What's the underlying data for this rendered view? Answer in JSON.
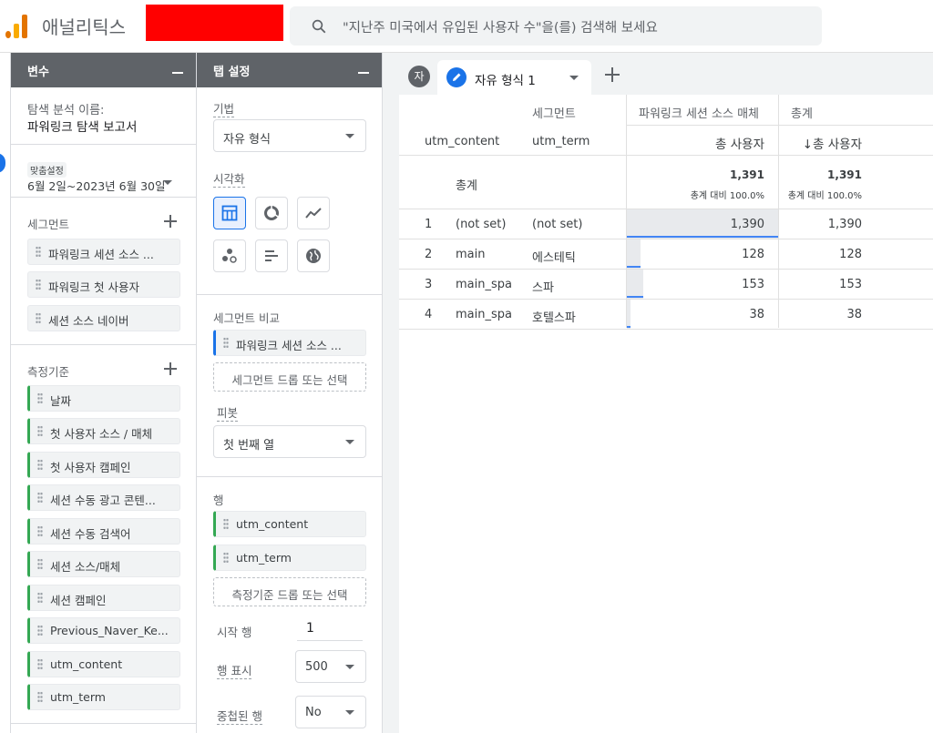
{
  "app": {
    "title": "애널리틱스",
    "search_placeholder": "\"지난주 미국에서 유입된 사용자 수\"을(를) 검색해 보세요"
  },
  "variables_panel": {
    "title": "변수",
    "exploration_name_label": "탐색 분석 이름:",
    "exploration_name": "파워링크 탐색 보고서",
    "date_badge": "맞춤설정",
    "date_range": "6월 2일~2023년 6월 30일",
    "segments_label": "세그먼트",
    "segments": [
      "파워링크 세션 소스 ...",
      "파워링크 첫 사용자",
      "세션 소스 네이버"
    ],
    "dimensions_label": "측정기준",
    "dimensions": [
      "날짜",
      "첫 사용자 소스 / 매체",
      "첫 사용자 캠페인",
      "세션 수동 광고 콘텐...",
      "세션 수동 검색어",
      "세션 소스/매체",
      "세션 캠페인",
      "Previous_Naver_Ke...",
      "utm_content",
      "utm_term"
    ]
  },
  "tab_settings": {
    "title": "탭 설정",
    "technique_label": "기법",
    "technique_value": "자유 형식",
    "visualization_label": "시각화",
    "segment_compare_label": "세그먼트 비교",
    "segment_compare_chip": "파워링크 세션 소스 ...",
    "segment_drop": "세그먼트 드롭 또는 선택",
    "pivot_label": "피봇",
    "pivot_value": "첫 번째 열",
    "rows_label": "행",
    "rows": [
      "utm_content",
      "utm_term"
    ],
    "dimension_drop": "측정기준 드롭 또는 선택",
    "start_row_label": "시작 행",
    "start_row_value": "1",
    "show_rows_label": "행 표시",
    "show_rows_value": "500",
    "nested_rows_label": "중첩된 행",
    "nested_rows_value": "No"
  },
  "tabs": {
    "avatar": "자",
    "active_tab": "자유 형식 1"
  },
  "table": {
    "segment_header": "세그먼트",
    "segment_col_header": "파워링크 세션 소스 매체",
    "total_col_header": "총계",
    "dim1_header": "utm_content",
    "dim2_header": "utm_term",
    "metric_header": "총 사용자",
    "metric_header_sorted": "↓총 사용자",
    "totals_label": "총계",
    "totals_value": "1,391",
    "totals_pct": "총계 대비 100.0%",
    "totals_value2": "1,391",
    "totals_pct2": "총계 대비 100.0%",
    "rows": [
      {
        "idx": "1",
        "content": "(not set)",
        "term": "(not set)",
        "seg_value": "1,390",
        "total": "1,390",
        "share": 0.999
      },
      {
        "idx": "2",
        "content": "main",
        "term": "에스테틱",
        "seg_value": "128",
        "total": "128",
        "share": 0.092
      },
      {
        "idx": "3",
        "content": "main_spa",
        "term": "스파",
        "seg_value": "153",
        "total": "153",
        "share": 0.11
      },
      {
        "idx": "4",
        "content": "main_spa",
        "term": "호텔스파",
        "seg_value": "38",
        "total": "38",
        "share": 0.027
      }
    ]
  },
  "colors": {
    "accent": "#1a73e8",
    "dimension_chip": "#34a853",
    "bar": "#4285f4",
    "header_bg": "#5f6368"
  }
}
